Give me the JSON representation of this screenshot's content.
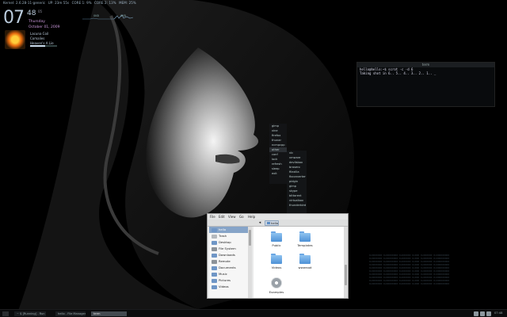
{
  "status": {
    "kernel": "Kernel: 2.6.28-11-generic",
    "uptime": "UP: 23m 55s",
    "core1": "CORE 1: 9%",
    "core2": "CORE 2: 13%",
    "mem": "MEM: 25%"
  },
  "net": {
    "down": "0KB",
    "up": "0KB"
  },
  "clock": {
    "hour": "07",
    "minute": "48",
    "second": "05",
    "weekday": "Thursday",
    "date": "October 01, 2009"
  },
  "music": {
    "line1": "Lacuna Coil",
    "line2": "Comalies",
    "line3": "Heaven's A Lie",
    "progress": 0.55
  },
  "terminal": {
    "title": "term",
    "lines": [
      "hello@hello:~$ scrot -c -d 6",
      "Taking shot in 6.. 5.. 4.. 3.. 2.. 1.. _"
    ]
  },
  "menu_main": [
    "gimp",
    "xine",
    "firefox",
    "thunar",
    "ncmpcpp",
    "other",
    "conf",
    "lock",
    "refresh",
    "sleep",
    "exit"
  ],
  "menu_main_active": 5,
  "menu_sub": [
    "vlc",
    "vmware",
    "devilsbox",
    "brasero",
    "filezilla",
    "fbconverter",
    "pidgin",
    "gimp",
    "skype",
    "bittorent",
    "virtualbox",
    "thunderbird"
  ],
  "fm": {
    "menus": [
      "File",
      "Edit",
      "View",
      "Go",
      "Help"
    ],
    "crumb": "hello",
    "sidebar": [
      "hello",
      "Trash",
      "Desktop",
      "File System",
      "Downloads",
      "Remote",
      "Documents",
      "Music",
      "Pictures",
      "Videos"
    ],
    "sidebar_selected": 0,
    "items": [
      "Public",
      "Templates",
      "Videos",
      "wwwroot",
      "Examples"
    ]
  },
  "dimtext": [
    "0x0000000 0x00000000 0x000000 0x000 0x000000 0x000000000",
    "0x0000000 0x00000000 0x000000 0x000 0x000000 0x000000000",
    "0x0000000 0x00000000 0x000000 0x000 0x000000 0x000000000",
    "0x0000000 0x00000000 0x000000 0x000 0x000000 0x000000000",
    "0x0000000 0x00000000 0x000000 0x000 0x000000 0x000000000",
    "0x0000000 0x00000000 0x000000 0x000 0x000000 0x000000000",
    "0x0000000 0x00000000 0x000000 0x000 0x000000 0x000000000",
    "0x0000000 0x00000000 0x000000 0x000 0x000000 0x000000000",
    "0x0000000 0x00000000 0x000000 0x000 0x000000 0x000000000",
    "0x0000000 0x00000000 0x000000 0x000 0x000000 0x000000000"
  ],
  "taskbar": {
    "tasks": [
      "~ $ [Running] - Run Whole...",
      "hello - File Manager",
      "term"
    ],
    "active": 2,
    "clock": "07:48"
  }
}
